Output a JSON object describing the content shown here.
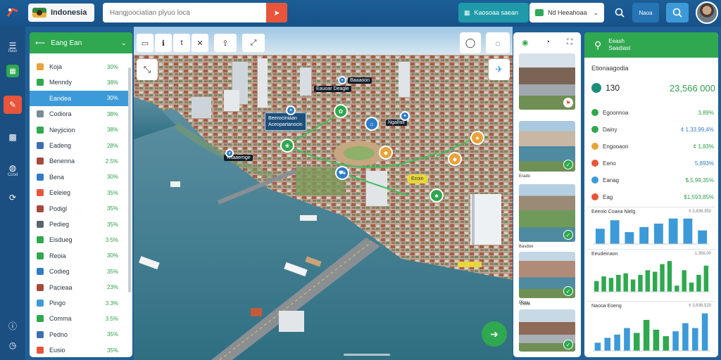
{
  "app": {
    "title": "Indonesia",
    "search_placeholder": "Hangjoociatian plyuo loca"
  },
  "topbar": {
    "teal_button": "Kaosoaa saean",
    "dropdown_value": "Nd Heeahoaa",
    "user_label": "Naoa"
  },
  "rail": {
    "items": [
      {
        "icon": "layers-icon",
        "label": "Nain"
      },
      {
        "icon": "map-grid-icon",
        "label": ""
      },
      {
        "icon": "edit-icon",
        "label": ""
      },
      {
        "icon": "qr-code-icon",
        "label": ""
      },
      {
        "icon": "globe-icon",
        "label": "Cuod"
      },
      {
        "icon": "share-icon",
        "label": ""
      },
      {
        "icon": "info-icon",
        "label": ""
      },
      {
        "icon": "clock-icon",
        "label": ""
      }
    ]
  },
  "list_panel": {
    "title": "Eang Ean",
    "items": [
      {
        "label": "Koja",
        "value": "30%",
        "color": "#e8a33a"
      },
      {
        "label": "Menndy",
        "value": "38%",
        "color": "#2fa84f"
      },
      {
        "label": "Eandea",
        "value": "30%",
        "color": "#3d9ad8",
        "selected": true
      },
      {
        "label": "Codiora",
        "value": "38%",
        "color": "#7a8a99"
      },
      {
        "label": "Neyjicion",
        "value": "38%",
        "color": "#2fa84f"
      },
      {
        "label": "Eadeng",
        "value": "28%",
        "color": "#3d6fb0"
      },
      {
        "label": "Benenna",
        "value": "2.5%",
        "color": "#a34a3a"
      },
      {
        "label": "Bena",
        "value": "30%",
        "color": "#2f7cc7"
      },
      {
        "label": "Eeleieg",
        "value": "35%",
        "color": "#e8553a"
      },
      {
        "label": "Podigl",
        "value": "35%",
        "color": "#a34a3a"
      },
      {
        "label": "Pedieg",
        "value": "35%",
        "color": "#5a6470"
      },
      {
        "label": "Eisdueg",
        "value": "3.5%",
        "color": "#2fa84f"
      },
      {
        "label": "Reoia",
        "value": "30%",
        "color": "#2fa84f"
      },
      {
        "label": "Codieg",
        "value": "35%",
        "color": "#2f7cc7"
      },
      {
        "label": "Pacieaa",
        "value": "23%",
        "color": "#a34a3a"
      },
      {
        "label": "Pingo",
        "value": "3.3%",
        "color": "#3d9ad8"
      },
      {
        "label": "Comma",
        "value": "3.5%",
        "color": "#2fa84f"
      },
      {
        "label": "Pedno",
        "value": "35%",
        "color": "#3d6fb0"
      },
      {
        "label": "Eusio",
        "value": "35%",
        "color": "#e8553a"
      }
    ]
  },
  "map_labels": [
    {
      "text": "Baaaoon",
      "kind": "dark"
    },
    {
      "text": "Eauoar Deagle",
      "kind": "dark"
    },
    {
      "text": "Beerociniaan\nAceopartanocin",
      "kind": "callout"
    },
    {
      "text": "Ngalfas",
      "kind": "dark"
    },
    {
      "text": "Tetaaemge",
      "kind": "dark"
    },
    {
      "text": "Ecoin",
      "kind": "yellow"
    }
  ],
  "thumbnails": [
    {
      "caption": ""
    },
    {
      "caption": "Erado"
    },
    {
      "caption": "Basdoo"
    },
    {
      "caption": "Pioou"
    },
    {
      "caption": "Eoou"
    }
  ],
  "stats": {
    "header": [
      "Eeash",
      "Saadiast"
    ],
    "title": "Etionaagodia",
    "kpi_left": "130",
    "kpi_right": "23,566 000",
    "rows": [
      {
        "label": "Egoonnoa",
        "value": "3,89%",
        "icon_color": "#2fa84f",
        "tone": "green"
      },
      {
        "label": "Dainy",
        "value": "¢ 1,33,99,4%",
        "icon_color": "#2fa84f",
        "tone": "blue"
      },
      {
        "label": "Engooaon",
        "value": "¢ 1,83%",
        "icon_color": "#e8a33a",
        "tone": "green"
      },
      {
        "label": "Eeno",
        "value": "5,893%",
        "icon_color": "#e8553a",
        "tone": "blue"
      },
      {
        "label": "Eanag",
        "value": "$,5,99,35%",
        "icon_color": "#3d9ad8",
        "tone": "green"
      },
      {
        "label": "Eag",
        "value": "$1,593,85%",
        "icon_color": "#e8553a",
        "tone": "green"
      }
    ]
  },
  "chart_data": [
    {
      "type": "bar",
      "title": "Eeenio Coaea Nielg",
      "value_label": "¢ 3,836,350",
      "colors": [
        "#3d9ad8",
        "#3d9ad8",
        "#3d9ad8",
        "#3d9ad8",
        "#3d9ad8",
        "#3d9ad8",
        "#3d9ad8",
        "#3d9ad8"
      ],
      "values": [
        18,
        28,
        14,
        20,
        24,
        30,
        30,
        16
      ]
    },
    {
      "type": "bar",
      "title": "Eeudeinaon",
      "value_label": "1,356,00",
      "colors": [
        "#2fa84f",
        "#2fa84f",
        "#2fa84f",
        "#2fa84f",
        "#2fa84f",
        "#2fa84f",
        "#2fa84f",
        "#2fa84f",
        "#2fa84f",
        "#2fa84f",
        "#2fa84f",
        "#2fa84f",
        "#2fa84f",
        "#2fa84f",
        "#2fa84f",
        "#2fa84f"
      ],
      "values": [
        14,
        20,
        18,
        22,
        24,
        16,
        22,
        28,
        26,
        36,
        40,
        8,
        28,
        12,
        22,
        34
      ]
    },
    {
      "type": "bar",
      "title": "Naooa Eoeng",
      "value_label": "¢ 3,836,520",
      "colors": [
        "#3d9ad8",
        "#3d9ad8",
        "#3d9ad8",
        "#3d9ad8",
        "#2fa84f",
        "#2fa84f",
        "#2fa84f",
        "#2fa84f",
        "#3d9ad8",
        "#3d9ad8",
        "#3d9ad8",
        "#3d9ad8"
      ],
      "values": [
        10,
        16,
        20,
        28,
        22,
        38,
        26,
        18,
        24,
        34,
        28,
        46
      ]
    }
  ]
}
